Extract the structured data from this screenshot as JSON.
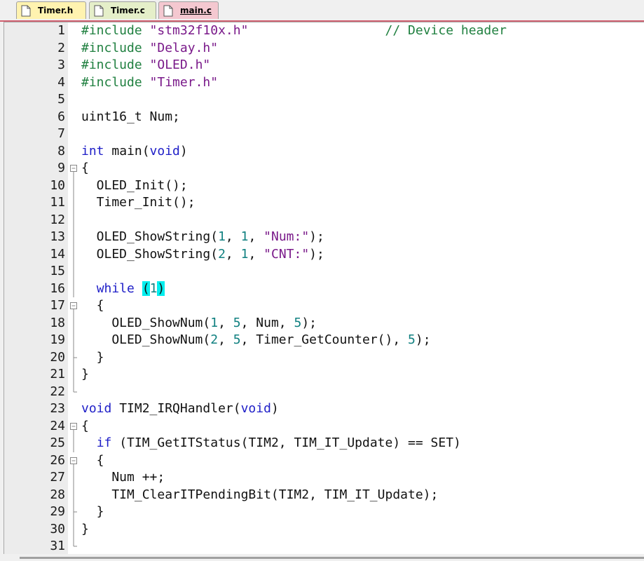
{
  "tabs": [
    {
      "label": "Timer.h",
      "icon": "file-icon"
    },
    {
      "label": "Timer.c",
      "icon": "file-icon"
    },
    {
      "label": "main.c",
      "icon": "file-icon",
      "active": true
    }
  ],
  "colors": {
    "keyword": "#2020c8",
    "preprocessor": "#208040",
    "string": "#7a1a8a",
    "number": "#108080",
    "comment": "#208040",
    "bracket_highlight": "#00eeee",
    "active_tab_accent": "#d06070"
  },
  "lines": [
    {
      "n": "1",
      "tokens": [
        [
          "pp",
          "#include "
        ],
        [
          "str",
          "\"stm32f10x.h\""
        ],
        [
          "",
          "                  "
        ],
        [
          "cm",
          "// Device header"
        ]
      ]
    },
    {
      "n": "2",
      "tokens": [
        [
          "pp",
          "#include "
        ],
        [
          "str",
          "\"Delay.h\""
        ]
      ]
    },
    {
      "n": "3",
      "tokens": [
        [
          "pp",
          "#include "
        ],
        [
          "str",
          "\"OLED.h\""
        ]
      ]
    },
    {
      "n": "4",
      "tokens": [
        [
          "pp",
          "#include "
        ],
        [
          "str",
          "\"Timer.h\""
        ]
      ]
    },
    {
      "n": "5",
      "tokens": []
    },
    {
      "n": "6",
      "tokens": [
        [
          "",
          "uint16_t Num;"
        ]
      ]
    },
    {
      "n": "7",
      "tokens": []
    },
    {
      "n": "8",
      "tokens": [
        [
          "kw",
          "int"
        ],
        [
          "",
          " main("
        ],
        [
          "kw",
          "void"
        ],
        [
          "",
          ")"
        ]
      ]
    },
    {
      "n": "9",
      "fold": "open",
      "tokens": [
        [
          "",
          "{"
        ]
      ]
    },
    {
      "n": "10",
      "fold": "line",
      "tokens": [
        [
          "",
          "  OLED_Init();"
        ]
      ]
    },
    {
      "n": "11",
      "fold": "line",
      "tokens": [
        [
          "",
          "  Timer_Init();"
        ]
      ]
    },
    {
      "n": "12",
      "fold": "line",
      "tokens": []
    },
    {
      "n": "13",
      "fold": "line",
      "tokens": [
        [
          "",
          "  OLED_ShowString("
        ],
        [
          "num",
          "1"
        ],
        [
          "",
          ", "
        ],
        [
          "num",
          "1"
        ],
        [
          "",
          ", "
        ],
        [
          "str",
          "\"Num:\""
        ],
        [
          "",
          ");"
        ]
      ]
    },
    {
      "n": "14",
      "fold": "line",
      "tokens": [
        [
          "",
          "  OLED_ShowString("
        ],
        [
          "num",
          "2"
        ],
        [
          "",
          ", "
        ],
        [
          "num",
          "1"
        ],
        [
          "",
          ", "
        ],
        [
          "str",
          "\"CNT:\""
        ],
        [
          "",
          ");"
        ]
      ]
    },
    {
      "n": "15",
      "fold": "line",
      "tokens": []
    },
    {
      "n": "16",
      "fold": "line",
      "tokens": [
        [
          "",
          "  "
        ],
        [
          "kw",
          "while"
        ],
        [
          "",
          " "
        ],
        [
          "hl",
          "("
        ],
        [
          "num",
          "1"
        ],
        [
          "hl",
          ")"
        ]
      ]
    },
    {
      "n": "17",
      "fold": "open",
      "tokens": [
        [
          "",
          "  {"
        ]
      ]
    },
    {
      "n": "18",
      "fold": "line",
      "tokens": [
        [
          "",
          "    OLED_ShowNum("
        ],
        [
          "num",
          "1"
        ],
        [
          "",
          ", "
        ],
        [
          "num",
          "5"
        ],
        [
          "",
          ", Num, "
        ],
        [
          "num",
          "5"
        ],
        [
          "",
          ");"
        ]
      ]
    },
    {
      "n": "19",
      "fold": "line",
      "tokens": [
        [
          "",
          "    OLED_ShowNum("
        ],
        [
          "num",
          "2"
        ],
        [
          "",
          ", "
        ],
        [
          "num",
          "5"
        ],
        [
          "",
          ", Timer_GetCounter(), "
        ],
        [
          "num",
          "5"
        ],
        [
          "",
          ");"
        ]
      ]
    },
    {
      "n": "20",
      "fold": "end-inner",
      "tokens": [
        [
          "",
          "  }"
        ]
      ]
    },
    {
      "n": "21",
      "fold": "end",
      "tokens": [
        [
          "",
          "}"
        ]
      ]
    },
    {
      "n": "22",
      "fold": "close",
      "tokens": []
    },
    {
      "n": "23",
      "tokens": [
        [
          "kw",
          "void"
        ],
        [
          "",
          " TIM2_IRQHandler("
        ],
        [
          "kw",
          "void"
        ],
        [
          "",
          ")"
        ]
      ]
    },
    {
      "n": "24",
      "fold": "open",
      "tokens": [
        [
          "",
          "{"
        ]
      ]
    },
    {
      "n": "25",
      "fold": "line",
      "tokens": [
        [
          "",
          "  "
        ],
        [
          "kw",
          "if"
        ],
        [
          "",
          " (TIM_GetITStatus(TIM2, TIM_IT_Update) == SET)"
        ]
      ]
    },
    {
      "n": "26",
      "fold": "open",
      "tokens": [
        [
          "",
          "  {"
        ]
      ]
    },
    {
      "n": "27",
      "fold": "line",
      "tokens": [
        [
          "",
          "    Num ++;"
        ]
      ]
    },
    {
      "n": "28",
      "fold": "line",
      "tokens": [
        [
          "",
          "    TIM_ClearITPendingBit(TIM2, TIM_IT_Update);"
        ]
      ]
    },
    {
      "n": "29",
      "fold": "end-inner",
      "tokens": [
        [
          "",
          "  }"
        ]
      ]
    },
    {
      "n": "30",
      "fold": "end",
      "tokens": [
        [
          "",
          "}"
        ]
      ]
    },
    {
      "n": "31",
      "fold": "close",
      "tokens": []
    }
  ]
}
